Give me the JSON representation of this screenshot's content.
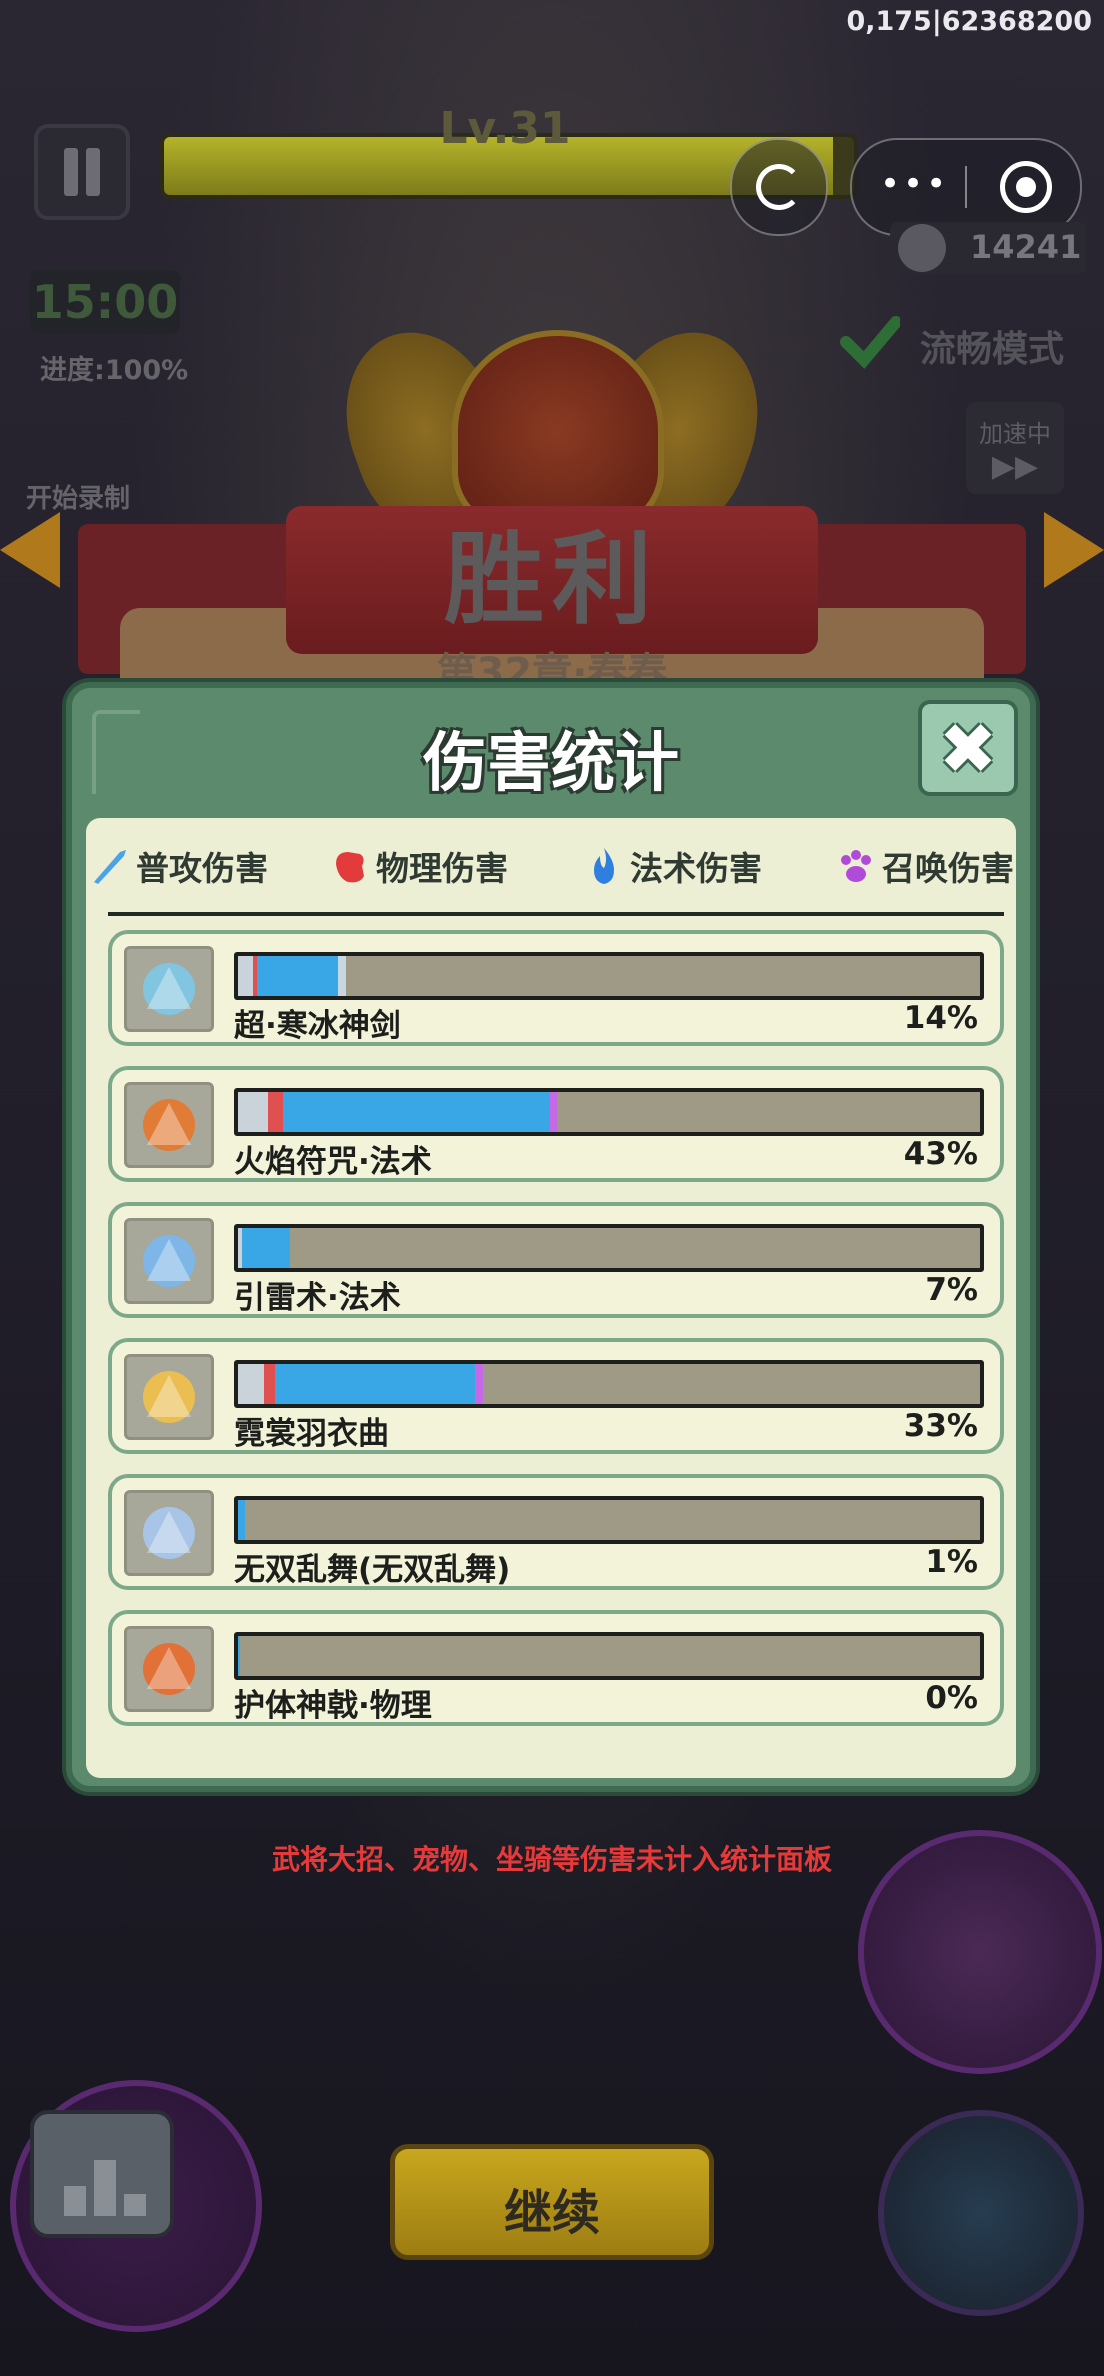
{
  "debug_id": "0,175|62368200",
  "hud": {
    "level": "Lv.31",
    "xp_progress": 0.97,
    "kills": "14241",
    "timer": "15:00",
    "progress": "进度:100%",
    "smooth_mode": "流畅模式",
    "speed_up": "加速中",
    "record": "开始录制"
  },
  "victory": {
    "title": "胜利",
    "chapter": "第32章·春春"
  },
  "modal": {
    "title": "伤害统计",
    "tabs": [
      {
        "label": "普攻伤害",
        "icon": "sword-icon",
        "color": "#4aa3e8"
      },
      {
        "label": "物理伤害",
        "icon": "fist-icon",
        "color": "#e33b3b"
      },
      {
        "label": "法术伤害",
        "icon": "flame-icon",
        "color": "#2f7fe0"
      },
      {
        "label": "召唤伤害",
        "icon": "paw-icon",
        "color": "#b04ad9"
      }
    ],
    "rows": [
      {
        "name": "超·寒冰神剑",
        "pct": "14%",
        "icon": "ice-sword-icon",
        "segments": [
          {
            "color": "#c9d3d9",
            "width": 0.02
          },
          {
            "color": "#e05050",
            "width": 0.005
          },
          {
            "color": "#39a6e6",
            "width": 0.11
          },
          {
            "color": "#c8d7e2",
            "width": 0.01
          }
        ]
      },
      {
        "name": "火焰符咒·法术",
        "pct": "43%",
        "icon": "fire-talisman-icon",
        "segments": [
          {
            "color": "#c9d3d9",
            "width": 0.04
          },
          {
            "color": "#e05050",
            "width": 0.02
          },
          {
            "color": "#39a6e6",
            "width": 0.36
          },
          {
            "color": "#c569e6",
            "width": 0.01
          }
        ]
      },
      {
        "name": "引雷术·法术",
        "pct": "7%",
        "icon": "lightning-icon",
        "segments": [
          {
            "color": "#c9d3d9",
            "width": 0.005
          },
          {
            "color": "#39a6e6",
            "width": 0.065
          }
        ]
      },
      {
        "name": "霓裳羽衣曲",
        "pct": "33%",
        "icon": "feather-dance-icon",
        "segments": [
          {
            "color": "#c9d3d9",
            "width": 0.035
          },
          {
            "color": "#e05050",
            "width": 0.015
          },
          {
            "color": "#39a6e6",
            "width": 0.27
          },
          {
            "color": "#c569e6",
            "width": 0.01
          }
        ]
      },
      {
        "name": "无双乱舞(无双乱舞)",
        "pct": "1%",
        "icon": "crystal-blade-icon",
        "segments": [
          {
            "color": "#39a6e6",
            "width": 0.01
          }
        ]
      },
      {
        "name": "护体神戟·物理",
        "pct": "0%",
        "icon": "halberd-icon",
        "segments": [
          {
            "color": "#39a6e6",
            "width": 0.003
          }
        ]
      }
    ]
  },
  "disclaimer": "武将大招、宠物、坐骑等伤害未计入统计面板",
  "continue_label": "继续"
}
